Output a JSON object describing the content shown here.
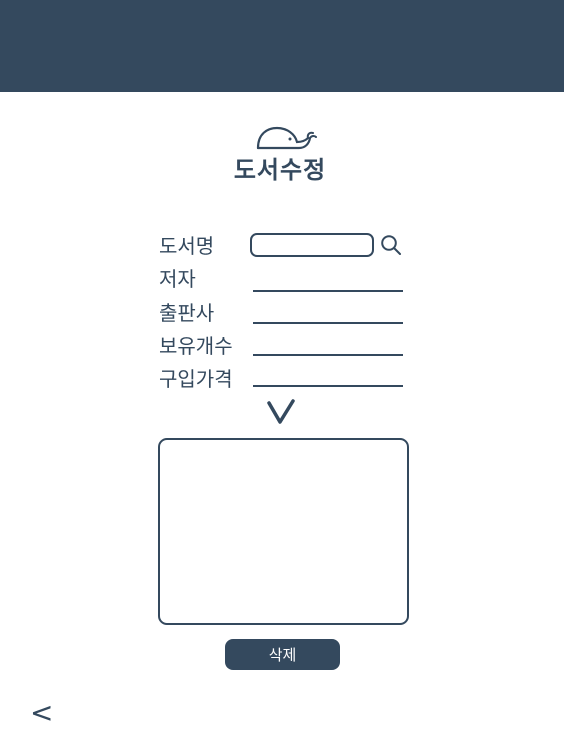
{
  "header": {
    "title": "도서수정",
    "logo_icon": "whale-icon",
    "bar_color": "#34495e"
  },
  "form": {
    "fields": [
      {
        "label": "도서명",
        "value": "",
        "type": "search"
      },
      {
        "label": "저자",
        "value": ""
      },
      {
        "label": "출판사",
        "value": ""
      },
      {
        "label": "보유개수",
        "value": ""
      },
      {
        "label": "구입가격",
        "value": ""
      }
    ],
    "search_icon": "search-icon",
    "confirm_icon": "checkmark-icon"
  },
  "detail": {
    "value": ""
  },
  "actions": {
    "delete_label": "삭제",
    "back_label": "<"
  }
}
